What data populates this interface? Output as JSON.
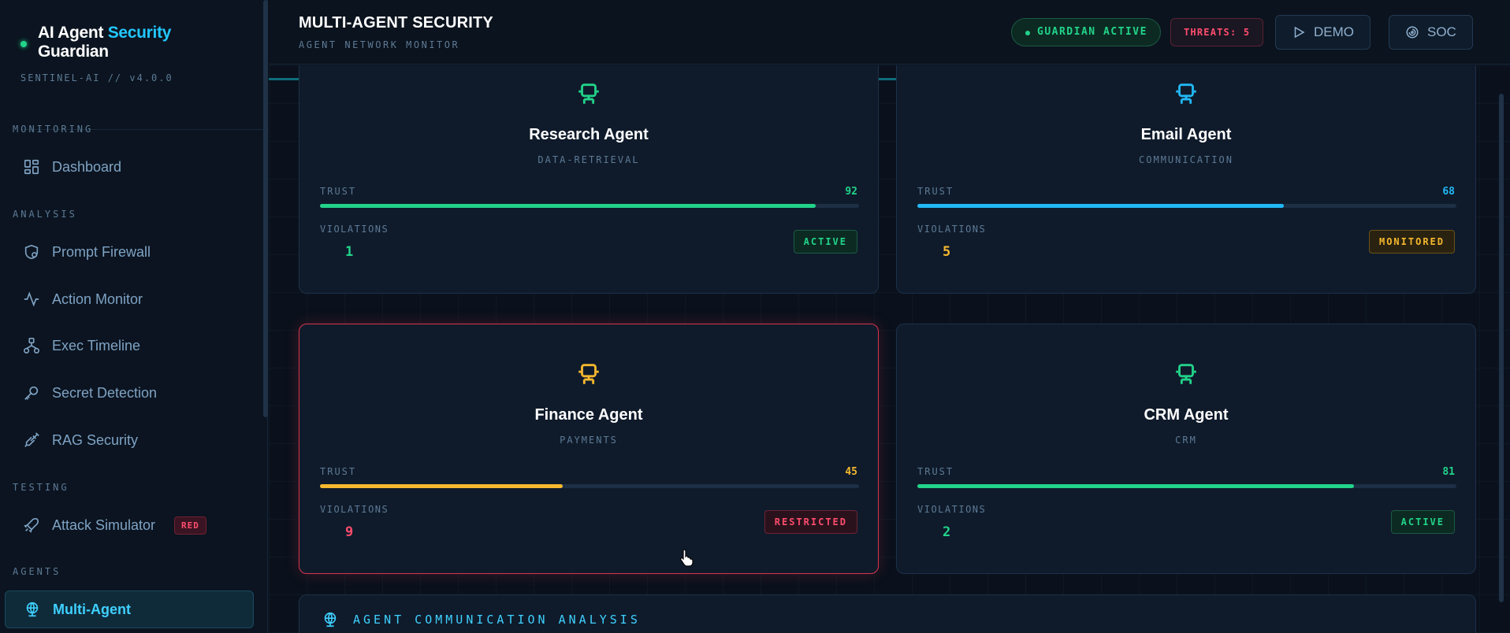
{
  "brand": {
    "title_main": "AI Agent ",
    "title_accent": "Security",
    "title_end": "Guardian",
    "subtitle": "SENTINEL-AI // v4.0.0"
  },
  "sidebar": {
    "sections": {
      "monitoring": "MONITORING",
      "analysis": "ANALYSIS",
      "testing": "TESTING",
      "agents": "AGENTS"
    },
    "items": [
      {
        "label": "Dashboard",
        "icon": "dashboard-icon"
      },
      {
        "label": "Prompt Firewall",
        "icon": "shield-icon"
      },
      {
        "label": "Action Monitor",
        "icon": "activity-icon"
      },
      {
        "label": "Exec Timeline",
        "icon": "network-icon"
      },
      {
        "label": "Secret Detection",
        "icon": "key-icon"
      },
      {
        "label": "RAG Security",
        "icon": "syringe-icon"
      },
      {
        "label": "Attack Simulator",
        "icon": "rocket-icon",
        "badge": "RED"
      },
      {
        "label": "Multi-Agent",
        "icon": "globe-icon",
        "active": true
      }
    ]
  },
  "header": {
    "title": "MULTI-AGENT SECURITY",
    "subtitle": "AGENT NETWORK MONITOR",
    "guardian": "GUARDIAN ACTIVE",
    "threats_label": "THREATS:",
    "threats_count": "5",
    "demo_label": "DEMO",
    "soc_label": "SOC"
  },
  "agents": [
    {
      "name": "Research Agent",
      "role": "DATA-RETRIEVAL",
      "trust_label": "TRUST",
      "trust": 92,
      "violations_label": "VIOLATIONS",
      "violations": "1",
      "status": "ACTIVE",
      "color": "#22d38a"
    },
    {
      "name": "Email Agent",
      "role": "COMMUNICATION",
      "trust_label": "TRUST",
      "trust": 68,
      "violations_label": "VIOLATIONS",
      "violations": "5",
      "status": "MONITORED",
      "color": "#22b8f5"
    },
    {
      "name": "Finance Agent",
      "role": "PAYMENTS",
      "trust_label": "TRUST",
      "trust": 45,
      "violations_label": "VIOLATIONS",
      "violations": "9",
      "status": "RESTRICTED",
      "color": "#f5b82e"
    },
    {
      "name": "CRM Agent",
      "role": "CRM",
      "trust_label": "TRUST",
      "trust": 81,
      "violations_label": "VIOLATIONS",
      "violations": "2",
      "status": "ACTIVE",
      "color": "#22d38a"
    }
  ],
  "comm": {
    "label": "AGENT COMMUNICATION ANALYSIS"
  },
  "colors": {
    "accent": "#22c7ff",
    "ok": "#22d38a",
    "warn": "#f5b82e",
    "danger": "#ff4d6d"
  }
}
